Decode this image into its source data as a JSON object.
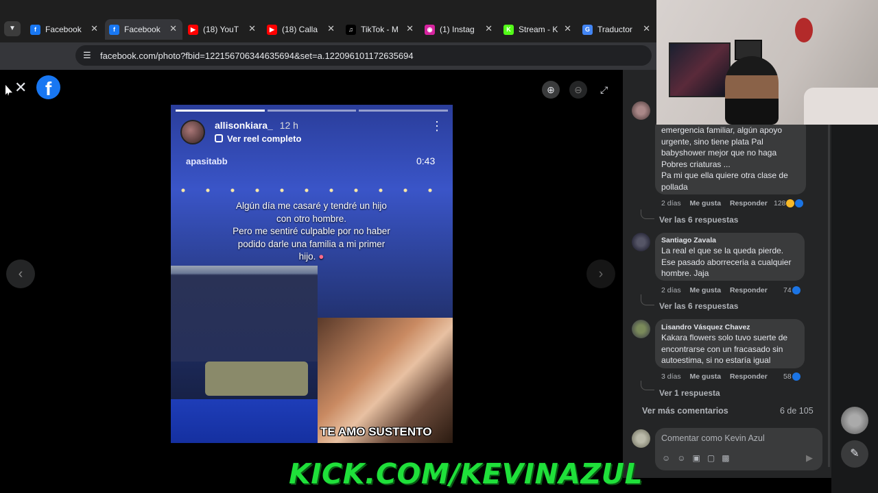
{
  "browser": {
    "tabs": [
      {
        "label": "Facebook",
        "icon": "facebook-icon",
        "color": "#1877f2",
        "active": false
      },
      {
        "label": "Facebook",
        "icon": "facebook-icon",
        "color": "#1877f2",
        "active": true
      },
      {
        "label": "(18) YouT",
        "icon": "youtube-icon",
        "color": "#ff0000",
        "active": false
      },
      {
        "label": "(18) Calla",
        "icon": "youtube-icon",
        "color": "#ff0000",
        "active": false
      },
      {
        "label": "TikTok - M",
        "icon": "tiktok-icon",
        "color": "#000000",
        "active": false
      },
      {
        "label": "(1) Instag",
        "icon": "instagram-icon",
        "color": "#d6249f",
        "active": false
      },
      {
        "label": "Stream - K",
        "icon": "kick-icon",
        "color": "#53fc18",
        "active": false
      },
      {
        "label": "Traductor",
        "icon": "translate-icon",
        "color": "#4285f4",
        "active": false
      }
    ],
    "url": "facebook.com/photo?fbid=122156706344635694&set=a.122096101172635694"
  },
  "story": {
    "username": "allisonkiara_",
    "time": "12 h",
    "reel_link": "Ver reel completo",
    "audio_user": "apasitabb",
    "duration": "0:43",
    "caption_lines": [
      "Algún día me casaré y tendré un hijo",
      "con otro hombre.",
      "Pero me sentiré culpable por no haber",
      "podido darle una familia a mi primer",
      "hijo."
    ],
    "inset_caption": "TE AMO SUSTENTO"
  },
  "comments": [
    {
      "lines": [
        "emergencia familiar, algún apoyo",
        "urgente, sino tiene plata Pal",
        "babyshower mejor que no haga",
        "Pobres criaturas ...",
        "Pa mi que ella quiere otra clase de",
        "pollada"
      ],
      "age": "2 días",
      "like": "Me gusta",
      "reply": "Responder",
      "count": "128",
      "replies": "Ver las 6 respuestas"
    },
    {
      "author": "Santiago Zavala",
      "lines": [
        "La real el que se la queda pierde.",
        "Ese pasado aborreceria a cualquier",
        "hombre. Jaja"
      ],
      "age": "2 días",
      "like": "Me gusta",
      "reply": "Responder",
      "count": "74",
      "replies": "Ver las 6 respuestas"
    },
    {
      "author": "Lisandro Vásquez Chavez",
      "lines": [
        "Kakara flowers solo tuvo suerte de",
        "encontrarse con un fracasado sin",
        "autoestima, si no estaría igual"
      ],
      "age": "3 días",
      "like": "Me gusta",
      "reply": "Responder",
      "count": "58",
      "replies": "Ver 1 respuesta"
    }
  ],
  "more_comments": "Ver más comentarios",
  "comment_count": "6 de 105",
  "composer_placeholder": "Comentar como Kevin Azul",
  "overlay_text": "KICK.COM/KEVINAZUL"
}
